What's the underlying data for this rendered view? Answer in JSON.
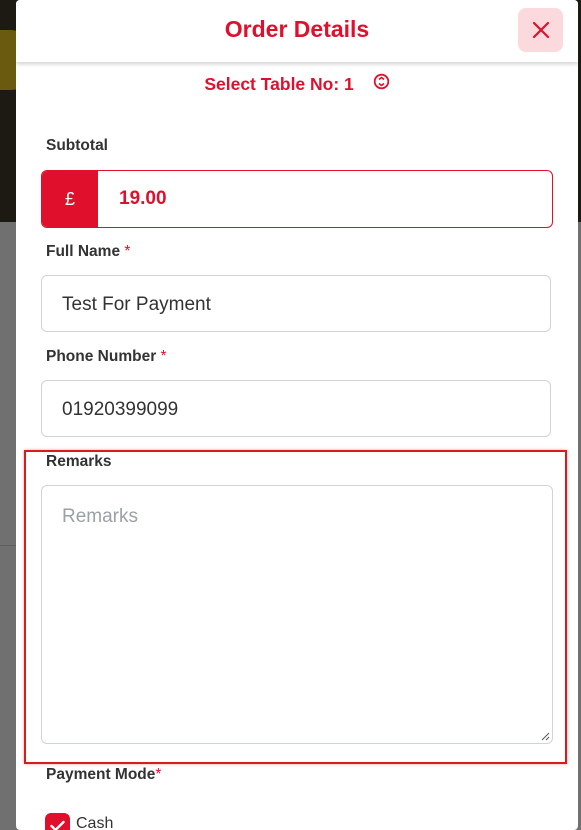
{
  "modal": {
    "title": "Order Details",
    "table_label": "Select Table No: 1"
  },
  "subtotal": {
    "label": "Subtotal",
    "currency": "£",
    "value": "19.00"
  },
  "full_name": {
    "label": "Full Name",
    "required_mark": "*",
    "value": "Test For Payment"
  },
  "phone": {
    "label": "Phone Number",
    "required_mark": "*",
    "value": "01920399099"
  },
  "remarks": {
    "label": "Remarks",
    "placeholder": "Remarks"
  },
  "payment": {
    "label": "Payment Mode",
    "required_mark": "*",
    "options": [
      {
        "label": "Cash",
        "checked": true
      }
    ]
  },
  "colors": {
    "accent": "#e0102d",
    "close_bg": "#fbd9dd",
    "highlight": "#d61d1d"
  },
  "icons": {
    "close": "close-icon",
    "refresh": "refresh-icon",
    "check": "check-icon"
  }
}
